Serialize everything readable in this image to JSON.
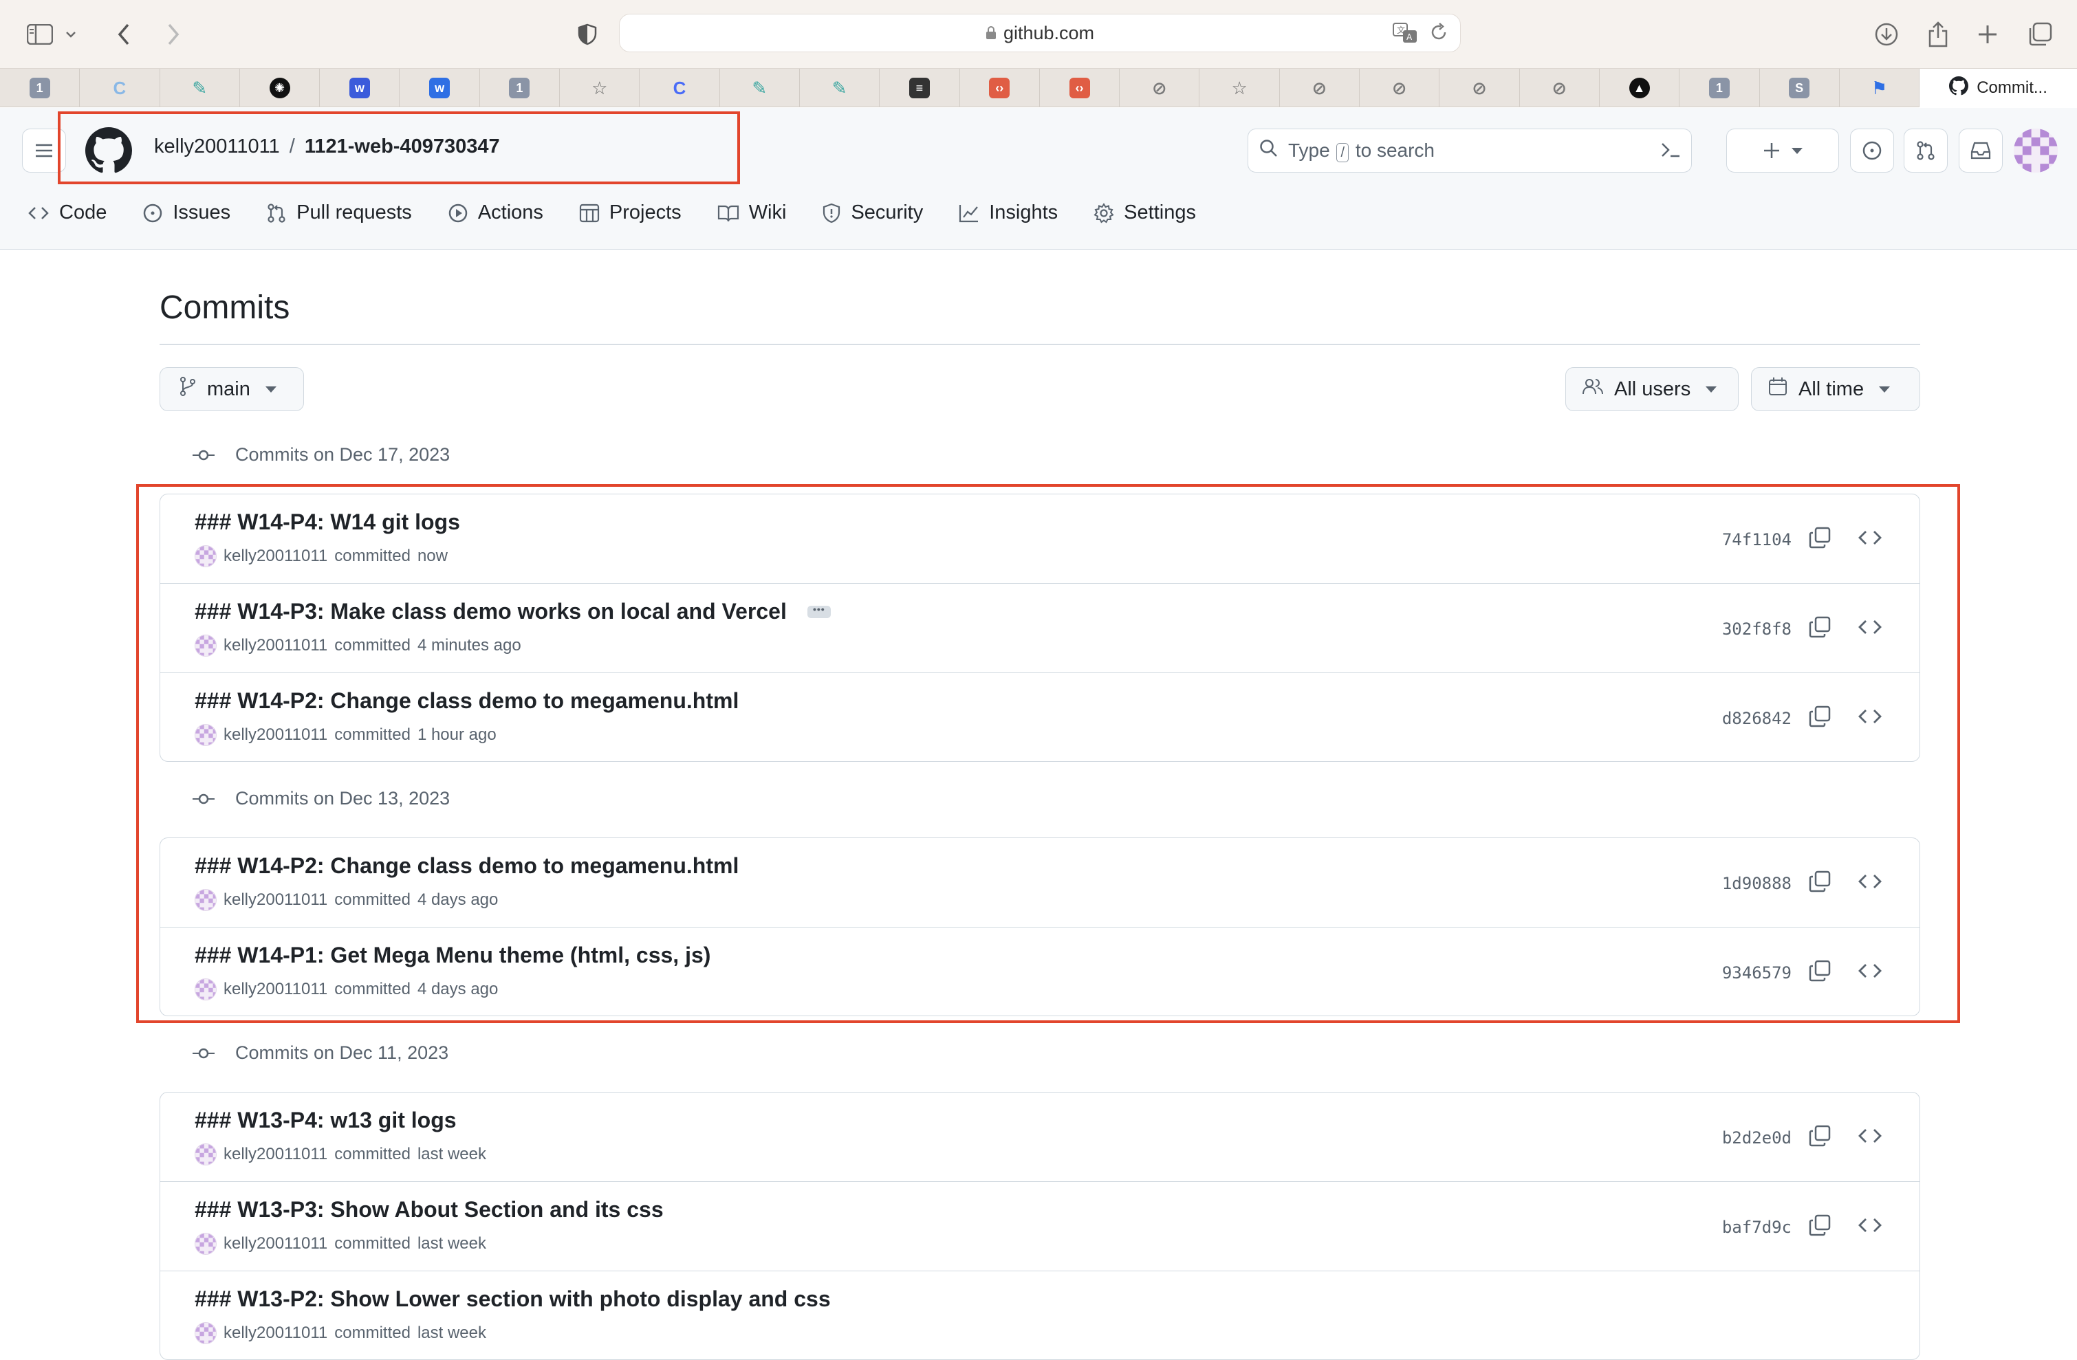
{
  "browser": {
    "url": "github.com",
    "active_tab_title": "Commit...",
    "favorites": [
      {
        "icon": "onepassword-icon",
        "text": "1",
        "color": "#8a94a6"
      },
      {
        "icon": "reload-icon",
        "text": "C",
        "color": "#8ab8e6"
      },
      {
        "icon": "quill-icon",
        "text": "✎",
        "color": "#3aa6a0"
      },
      {
        "icon": "openai-icon",
        "text": "✺",
        "color": "#111111"
      },
      {
        "icon": "w-icon",
        "text": "w",
        "color": "#3b5bdb"
      },
      {
        "icon": "w-icon",
        "text": "w",
        "color": "#2f6fe4"
      },
      {
        "icon": "onepassword-icon",
        "text": "1",
        "color": "#8a94a6"
      },
      {
        "icon": "star-icon",
        "text": "☆",
        "color": "#6b6b6b"
      },
      {
        "icon": "c-icon",
        "text": "C",
        "color": "#4a6cf7"
      },
      {
        "icon": "quill-icon",
        "text": "✎",
        "color": "#3aa6a0"
      },
      {
        "icon": "quill-icon",
        "text": "✎",
        "color": "#3aa6a0"
      },
      {
        "icon": "document-icon",
        "text": "≡",
        "color": "#333333"
      },
      {
        "icon": "code-badge-icon",
        "text": "‹›",
        "color": "#e05d44"
      },
      {
        "icon": "code-badge-icon",
        "text": "‹›",
        "color": "#e05d44"
      },
      {
        "icon": "compass-icon",
        "text": "⊘",
        "color": "#7a7a7a"
      },
      {
        "icon": "star-icon",
        "text": "☆",
        "color": "#6b6b6b"
      },
      {
        "icon": "compass-icon",
        "text": "⊘",
        "color": "#7a7a7a"
      },
      {
        "icon": "compass-icon",
        "text": "⊘",
        "color": "#7a7a7a"
      },
      {
        "icon": "compass-icon",
        "text": "⊘",
        "color": "#7a7a7a"
      },
      {
        "icon": "compass-icon",
        "text": "⊘",
        "color": "#7a7a7a"
      },
      {
        "icon": "triangle-icon",
        "text": "▲",
        "color": "#111111"
      },
      {
        "icon": "onepassword-icon",
        "text": "1",
        "color": "#8a94a6"
      },
      {
        "icon": "s-icon",
        "text": "S",
        "color": "#8a94a6"
      },
      {
        "icon": "flag-icon",
        "text": "⚑",
        "color": "#2f6fe4"
      }
    ]
  },
  "header": {
    "owner": "kelly20011011",
    "separator": "/",
    "repo": "1121-web-409730347",
    "search_prefix": "Type",
    "search_key": "/",
    "search_suffix": "to search"
  },
  "repo_nav": [
    {
      "label": "Code",
      "icon": "code-icon"
    },
    {
      "label": "Issues",
      "icon": "issue-icon"
    },
    {
      "label": "Pull requests",
      "icon": "pull-request-icon"
    },
    {
      "label": "Actions",
      "icon": "play-icon"
    },
    {
      "label": "Projects",
      "icon": "table-icon"
    },
    {
      "label": "Wiki",
      "icon": "book-icon"
    },
    {
      "label": "Security",
      "icon": "shield-icon"
    },
    {
      "label": "Insights",
      "icon": "graph-icon"
    },
    {
      "label": "Settings",
      "icon": "gear-icon"
    }
  ],
  "page": {
    "title": "Commits",
    "branch": "main",
    "users_filter": "All users",
    "time_filter": "All time"
  },
  "groups": [
    {
      "heading": "Commits on Dec 17, 2023",
      "commits": [
        {
          "message": "### W14-P4: W14 git logs",
          "author": "kelly20011011",
          "verb": "committed",
          "when": "now",
          "sha": "74f1104",
          "ellipsis": false
        },
        {
          "message": "### W14-P3: Make class demo works on local and Vercel",
          "author": "kelly20011011",
          "verb": "committed",
          "when": "4 minutes ago",
          "sha": "302f8f8",
          "ellipsis": true
        },
        {
          "message": "### W14-P2: Change class demo to megamenu.html",
          "author": "kelly20011011",
          "verb": "committed",
          "when": "1 hour ago",
          "sha": "d826842",
          "ellipsis": false
        }
      ]
    },
    {
      "heading": "Commits on Dec 13, 2023",
      "commits": [
        {
          "message": "### W14-P2: Change class demo to megamenu.html",
          "author": "kelly20011011",
          "verb": "committed",
          "when": "4 days ago",
          "sha": "1d90888",
          "ellipsis": false
        },
        {
          "message": "### W14-P1: Get Mega Menu theme (html, css, js)",
          "author": "kelly20011011",
          "verb": "committed",
          "when": "4 days ago",
          "sha": "9346579",
          "ellipsis": false
        }
      ]
    },
    {
      "heading": "Commits on Dec 11, 2023",
      "commits": [
        {
          "message": "### W13-P4: w13 git logs",
          "author": "kelly20011011",
          "verb": "committed",
          "when": "last week",
          "sha": "b2d2e0d",
          "ellipsis": false
        },
        {
          "message": "### W13-P3: Show About Section and its css",
          "author": "kelly20011011",
          "verb": "committed",
          "when": "last week",
          "sha": "baf7d9c",
          "ellipsis": false
        },
        {
          "message": "### W13-P2: Show Lower section with photo display and css",
          "author": "kelly20011011",
          "verb": "committed",
          "when": "last week",
          "sha": "",
          "ellipsis": false
        }
      ]
    }
  ],
  "highlight_color": "#e2452c"
}
